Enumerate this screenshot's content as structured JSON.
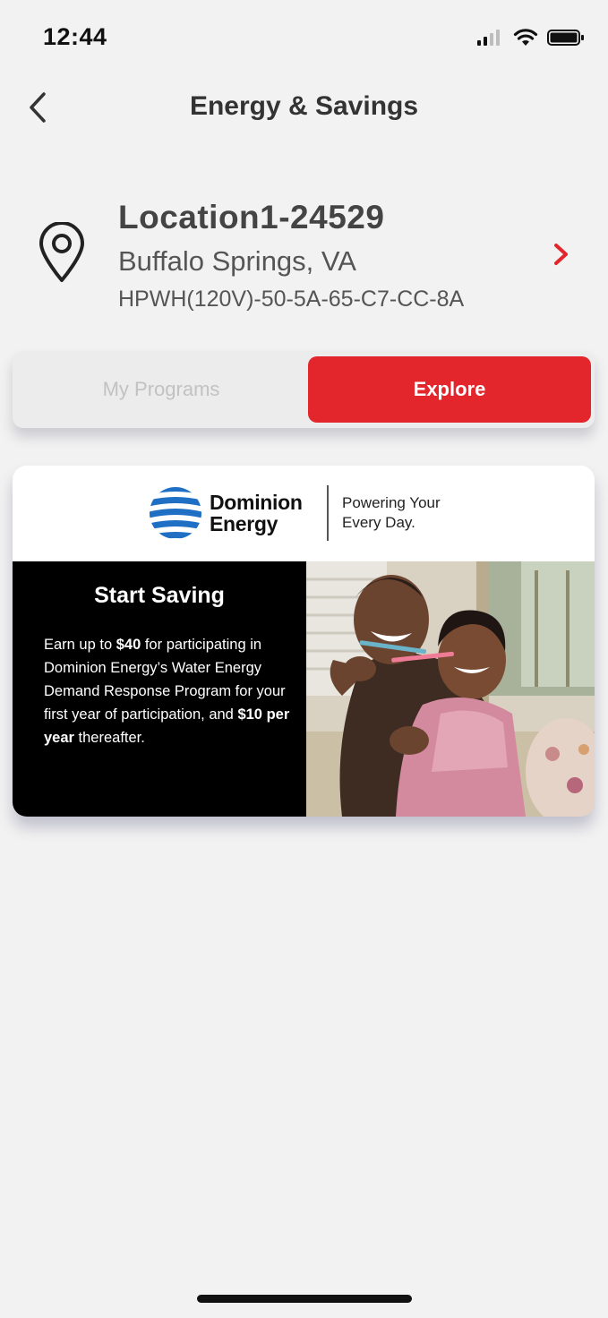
{
  "status_bar": {
    "time": "12:44",
    "icons": [
      "cellular-signal-icon",
      "wifi-icon",
      "battery-icon"
    ]
  },
  "header": {
    "title": "Energy & Savings",
    "back_icon": "chevron-left-icon"
  },
  "location": {
    "name": "Location1-24529",
    "city": "Buffalo Springs, VA",
    "device": "HPWH(120V)-50-5A-65-C7-CC-8A",
    "icon": "location-pin-icon",
    "chevron_icon": "chevron-right-icon"
  },
  "tabs": [
    {
      "label": "My Programs",
      "selected": false
    },
    {
      "label": "Explore",
      "selected": true
    }
  ],
  "promo": {
    "brand_line1": "Dominion",
    "brand_line2": "Energy",
    "tagline_line1": "Powering Your",
    "tagline_line2": "Every Day.",
    "heading": "Start Saving",
    "body_1": "Earn up to ",
    "body_2": "$40",
    "body_3": " for participating in Dominion Energy’s Water Energy Demand Response Program for your first year of participation, and ",
    "body_4": "$10 per year",
    "body_5": " thereafter."
  },
  "colors": {
    "accent": "#e2262c",
    "background": "#f2f2f2",
    "brand_blue": "#1f6fc4",
    "promo_panel": "#000000"
  }
}
